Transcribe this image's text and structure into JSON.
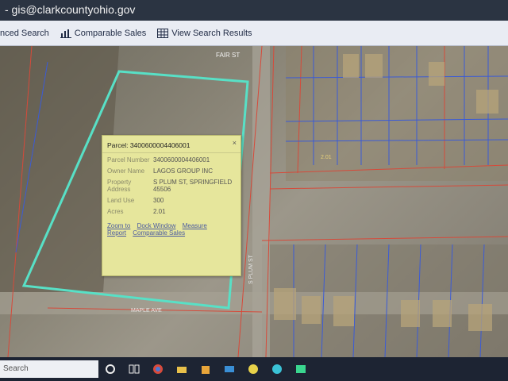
{
  "titlebar": {
    "text": "- gis@clarkcountyohio.gov"
  },
  "toolbar": {
    "advanced_search": "nced Search",
    "comparable_sales": "Comparable Sales",
    "view_results": "View Search Results"
  },
  "map": {
    "street_fair": "FAIR ST",
    "street_plum": "S PLUM ST",
    "street_bottom": "MAPLE AVE",
    "parcel_label": "2.01",
    "highlight_color": "#58e0c6",
    "lot_line_color": "#d64a3a",
    "parcel_line_color": "#3b5bd6"
  },
  "popup": {
    "title": "Parcel: 3400600004406001",
    "close_icon": "×",
    "fields": [
      {
        "label": "Parcel Number",
        "value": "3400600004406001"
      },
      {
        "label": "Owner Name",
        "value": "LAGOS GROUP INC"
      },
      {
        "label": "Property Address",
        "value": "S PLUM ST, SPRINGFIELD 45506"
      },
      {
        "label": "Land Use",
        "value": "300"
      },
      {
        "label": "Acres",
        "value": "2.01"
      }
    ],
    "links": [
      "Zoom to",
      "Dock Window",
      "Measure",
      "Report",
      "Comparable Sales"
    ]
  },
  "taskbar": {
    "search_text": "Search"
  }
}
